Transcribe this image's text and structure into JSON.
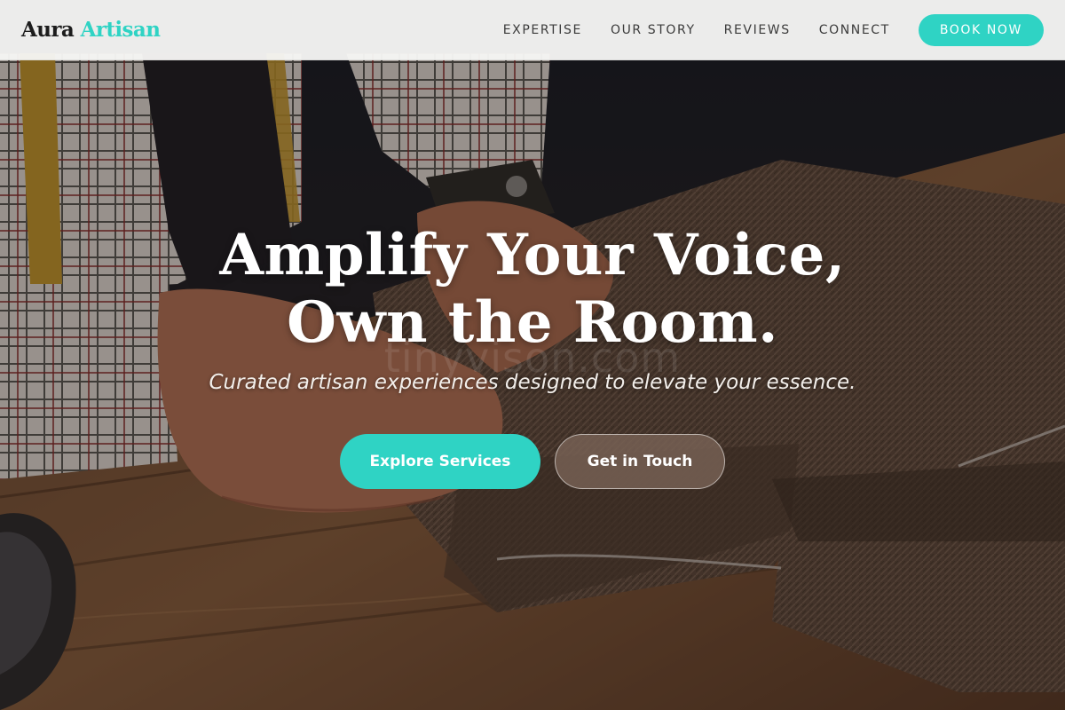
{
  "brand": {
    "name_part1": "Aura",
    "name_part2": "Artisan",
    "accent_color": "#2fd3c4",
    "dark_color": "#1c1c1c"
  },
  "nav": {
    "items": [
      {
        "label": "EXPERTISE"
      },
      {
        "label": "OUR STORY"
      },
      {
        "label": "REVIEWS"
      },
      {
        "label": "CONNECT"
      }
    ],
    "cta_label": "BOOK NOW"
  },
  "hero": {
    "headline_line1": "Amplify Your Voice,",
    "headline_line2": "Own the Room.",
    "watermark": "tinyvison.com",
    "subtitle": "Curated artisan experiences designed to elevate your essence.",
    "primary_button": "Explore Services",
    "secondary_button": "Get in Touch",
    "background_image": "tailor-hands-cutting-tweed-fabric-on-wooden-table"
  }
}
